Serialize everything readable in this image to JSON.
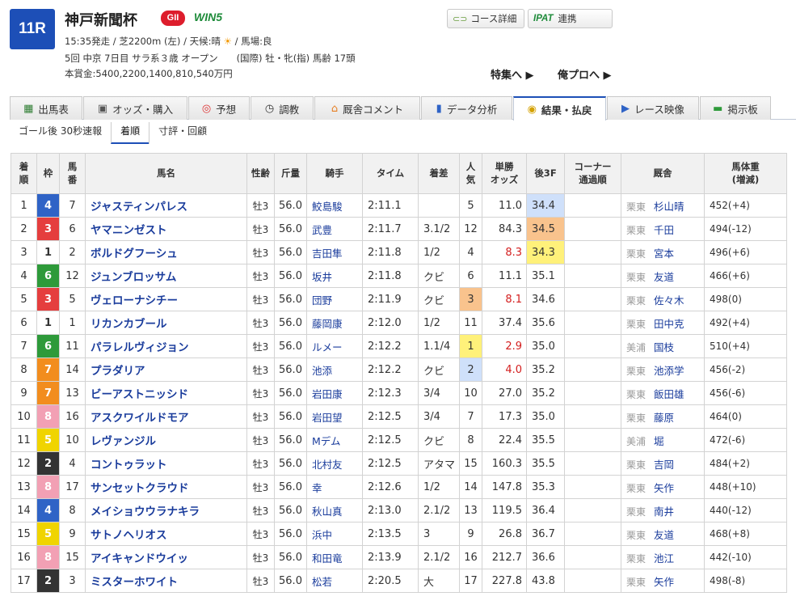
{
  "race": {
    "number": "11R",
    "name": "神戸新聞杯",
    "grade": "GII",
    "win5": "WIN5",
    "info_line1": "15:35発走 / 芝2200m (左) / 天候:晴",
    "weather_icon": "sun-icon",
    "info_line1b": "/ 馬場:良",
    "info_line2": "5回 中京 7日目 サラ系３歳 オープン　　(国際) 牡・牝(指) 馬齢 17頭",
    "info_line3": "本賞金:5400,2200,1400,810,540万円"
  },
  "buttons": {
    "course": "コース詳細",
    "ipat": "IPAT",
    "ipat_link": "連携"
  },
  "links": {
    "special": "特集へ ▶",
    "pro": "俺プロへ ▶"
  },
  "tabs": [
    {
      "icon": "table-icon",
      "label": "出馬表",
      "glyph": "▦"
    },
    {
      "icon": "odds-icon",
      "label": "オッズ・購入",
      "glyph": "▣"
    },
    {
      "icon": "target-icon",
      "label": "予想",
      "glyph": "◎"
    },
    {
      "icon": "stopwatch-icon",
      "label": "調教",
      "glyph": "◷"
    },
    {
      "icon": "stable-icon",
      "label": "厩舎コメント",
      "glyph": "⌂"
    },
    {
      "icon": "bar-chart-icon",
      "label": "データ分析",
      "glyph": "▮"
    },
    {
      "icon": "coins-icon",
      "label": "結果・払戻",
      "glyph": "◉"
    },
    {
      "icon": "video-icon",
      "label": "レース映像",
      "glyph": "▶"
    },
    {
      "icon": "chat-icon",
      "label": "掲示板",
      "glyph": "▬"
    }
  ],
  "subtabs": [
    "ゴール後 30秒速報",
    "着順",
    "寸評・回顧"
  ],
  "headers": {
    "rank": [
      "着",
      "順"
    ],
    "gate": "枠",
    "num": [
      "馬",
      "番"
    ],
    "horse": "馬名",
    "sexage": "性齢",
    "weight": "斤量",
    "jockey": "騎手",
    "time": "タイム",
    "margin": "着差",
    "pop": [
      "人",
      "気"
    ],
    "odds": [
      "単勝",
      "オッズ"
    ],
    "last3f": "後3F",
    "corner": [
      "コーナー",
      "通過順"
    ],
    "trainer": "厩舎",
    "bodyweight": [
      "馬体重",
      "(増減)"
    ]
  },
  "colors": {
    "gate1": "#ffffff",
    "gate2": "#333333",
    "gate3": "#e53e3e",
    "gate4": "#2f63c6",
    "gate5": "#f0d400",
    "gate6": "#2e9a3a",
    "gate7": "#f28d1e",
    "gate8": "#f2a0b4"
  },
  "rows": [
    {
      "rank": "1",
      "gate": "4",
      "num": "7",
      "horse": "ジャスティンパレス",
      "sexage": "牡3",
      "weight": "56.0",
      "jockey": "鮫島駿",
      "time": "2:11.1",
      "margin": "",
      "pop": "5",
      "odds": "11.0",
      "odds_hot": false,
      "last3f": "34.4",
      "f3": "2",
      "corner": "",
      "aff": "栗東",
      "trainer": "杉山晴",
      "bw": "452(+4)",
      "pop_hl": ""
    },
    {
      "rank": "2",
      "gate": "3",
      "num": "6",
      "horse": "ヤマニンゼスト",
      "sexage": "牡3",
      "weight": "56.0",
      "jockey": "武豊",
      "time": "2:11.7",
      "margin": "3.1/2",
      "pop": "12",
      "odds": "84.3",
      "odds_hot": false,
      "last3f": "34.5",
      "f3": "3",
      "corner": "",
      "aff": "栗東",
      "trainer": "千田",
      "bw": "494(-12)",
      "pop_hl": ""
    },
    {
      "rank": "3",
      "gate": "1",
      "num": "2",
      "horse": "ボルドグフーシュ",
      "sexage": "牡3",
      "weight": "56.0",
      "jockey": "吉田隼",
      "time": "2:11.8",
      "margin": "1/2",
      "pop": "4",
      "odds": "8.3",
      "odds_hot": true,
      "last3f": "34.3",
      "f3": "1",
      "corner": "",
      "aff": "栗東",
      "trainer": "宮本",
      "bw": "496(+6)",
      "pop_hl": ""
    },
    {
      "rank": "4",
      "gate": "6",
      "num": "12",
      "horse": "ジュンブロッサム",
      "sexage": "牡3",
      "weight": "56.0",
      "jockey": "坂井",
      "time": "2:11.8",
      "margin": "クビ",
      "pop": "6",
      "odds": "11.1",
      "odds_hot": false,
      "last3f": "35.1",
      "f3": "",
      "corner": "",
      "aff": "栗東",
      "trainer": "友道",
      "bw": "466(+6)",
      "pop_hl": ""
    },
    {
      "rank": "5",
      "gate": "3",
      "num": "5",
      "horse": "ヴェローナシチー",
      "sexage": "牡3",
      "weight": "56.0",
      "jockey": "団野",
      "time": "2:11.9",
      "margin": "クビ",
      "pop": "3",
      "odds": "8.1",
      "odds_hot": true,
      "last3f": "34.6",
      "f3": "",
      "corner": "",
      "aff": "栗東",
      "trainer": "佐々木",
      "bw": "498(0)",
      "pop_hl": "3"
    },
    {
      "rank": "6",
      "gate": "1",
      "num": "1",
      "horse": "リカンカブール",
      "sexage": "牡3",
      "weight": "56.0",
      "jockey": "藤岡康",
      "time": "2:12.0",
      "margin": "1/2",
      "pop": "11",
      "odds": "37.4",
      "odds_hot": false,
      "last3f": "35.6",
      "f3": "",
      "corner": "",
      "aff": "栗東",
      "trainer": "田中克",
      "bw": "492(+4)",
      "pop_hl": ""
    },
    {
      "rank": "7",
      "gate": "6",
      "num": "11",
      "horse": "パラレルヴィジョン",
      "sexage": "牡3",
      "weight": "56.0",
      "jockey": "ルメー",
      "time": "2:12.2",
      "margin": "1.1/4",
      "pop": "1",
      "odds": "2.9",
      "odds_hot": true,
      "last3f": "35.0",
      "f3": "",
      "corner": "",
      "aff": "美浦",
      "trainer": "国枝",
      "bw": "510(+4)",
      "pop_hl": "1"
    },
    {
      "rank": "8",
      "gate": "7",
      "num": "14",
      "horse": "プラダリア",
      "sexage": "牡3",
      "weight": "56.0",
      "jockey": "池添",
      "time": "2:12.2",
      "margin": "クビ",
      "pop": "2",
      "odds": "4.0",
      "odds_hot": true,
      "last3f": "35.2",
      "f3": "",
      "corner": "",
      "aff": "栗東",
      "trainer": "池添学",
      "bw": "456(-2)",
      "pop_hl": "2"
    },
    {
      "rank": "9",
      "gate": "7",
      "num": "13",
      "horse": "ビーアストニッシド",
      "sexage": "牡3",
      "weight": "56.0",
      "jockey": "岩田康",
      "time": "2:12.3",
      "margin": "3/4",
      "pop": "10",
      "odds": "27.0",
      "odds_hot": false,
      "last3f": "35.2",
      "f3": "",
      "corner": "",
      "aff": "栗東",
      "trainer": "飯田雄",
      "bw": "456(-6)",
      "pop_hl": ""
    },
    {
      "rank": "10",
      "gate": "8",
      "num": "16",
      "horse": "アスクワイルドモア",
      "sexage": "牡3",
      "weight": "56.0",
      "jockey": "岩田望",
      "time": "2:12.5",
      "margin": "3/4",
      "pop": "7",
      "odds": "17.3",
      "odds_hot": false,
      "last3f": "35.0",
      "f3": "",
      "corner": "",
      "aff": "栗東",
      "trainer": "藤原",
      "bw": "464(0)",
      "pop_hl": ""
    },
    {
      "rank": "11",
      "gate": "5",
      "num": "10",
      "horse": "レヴァンジル",
      "sexage": "牡3",
      "weight": "56.0",
      "jockey": "Mデム",
      "time": "2:12.5",
      "margin": "クビ",
      "pop": "8",
      "odds": "22.4",
      "odds_hot": false,
      "last3f": "35.5",
      "f3": "",
      "corner": "",
      "aff": "美浦",
      "trainer": "堀",
      "bw": "472(-6)",
      "pop_hl": ""
    },
    {
      "rank": "12",
      "gate": "2",
      "num": "4",
      "horse": "コントゥラット",
      "sexage": "牡3",
      "weight": "56.0",
      "jockey": "北村友",
      "time": "2:12.5",
      "margin": "アタマ",
      "pop": "15",
      "odds": "160.3",
      "odds_hot": false,
      "last3f": "35.5",
      "f3": "",
      "corner": "",
      "aff": "栗東",
      "trainer": "吉岡",
      "bw": "484(+2)",
      "pop_hl": ""
    },
    {
      "rank": "13",
      "gate": "8",
      "num": "17",
      "horse": "サンセットクラウド",
      "sexage": "牡3",
      "weight": "56.0",
      "jockey": "幸",
      "time": "2:12.6",
      "margin": "1/2",
      "pop": "14",
      "odds": "147.8",
      "odds_hot": false,
      "last3f": "35.3",
      "f3": "",
      "corner": "",
      "aff": "栗東",
      "trainer": "矢作",
      "bw": "448(+10)",
      "pop_hl": ""
    },
    {
      "rank": "14",
      "gate": "4",
      "num": "8",
      "horse": "メイショウウラナキラ",
      "sexage": "牡3",
      "weight": "56.0",
      "jockey": "秋山真",
      "time": "2:13.0",
      "margin": "2.1/2",
      "pop": "13",
      "odds": "119.5",
      "odds_hot": false,
      "last3f": "36.4",
      "f3": "",
      "corner": "",
      "aff": "栗東",
      "trainer": "南井",
      "bw": "440(-12)",
      "pop_hl": ""
    },
    {
      "rank": "15",
      "gate": "5",
      "num": "9",
      "horse": "サトノヘリオス",
      "sexage": "牡3",
      "weight": "56.0",
      "jockey": "浜中",
      "time": "2:13.5",
      "margin": "3",
      "pop": "9",
      "odds": "26.8",
      "odds_hot": false,
      "last3f": "36.7",
      "f3": "",
      "corner": "",
      "aff": "栗東",
      "trainer": "友道",
      "bw": "468(+8)",
      "pop_hl": ""
    },
    {
      "rank": "16",
      "gate": "8",
      "num": "15",
      "horse": "アイキャンドウイッ",
      "sexage": "牡3",
      "weight": "56.0",
      "jockey": "和田竜",
      "time": "2:13.9",
      "margin": "2.1/2",
      "pop": "16",
      "odds": "212.7",
      "odds_hot": false,
      "last3f": "36.6",
      "f3": "",
      "corner": "",
      "aff": "栗東",
      "trainer": "池江",
      "bw": "442(-10)",
      "pop_hl": ""
    },
    {
      "rank": "17",
      "gate": "2",
      "num": "3",
      "horse": "ミスターホワイト",
      "sexage": "牡3",
      "weight": "56.0",
      "jockey": "松若",
      "time": "2:20.5",
      "margin": "大",
      "pop": "17",
      "odds": "227.8",
      "odds_hot": false,
      "last3f": "43.8",
      "f3": "",
      "corner": "",
      "aff": "栗東",
      "trainer": "矢作",
      "bw": "498(-8)",
      "pop_hl": ""
    }
  ]
}
